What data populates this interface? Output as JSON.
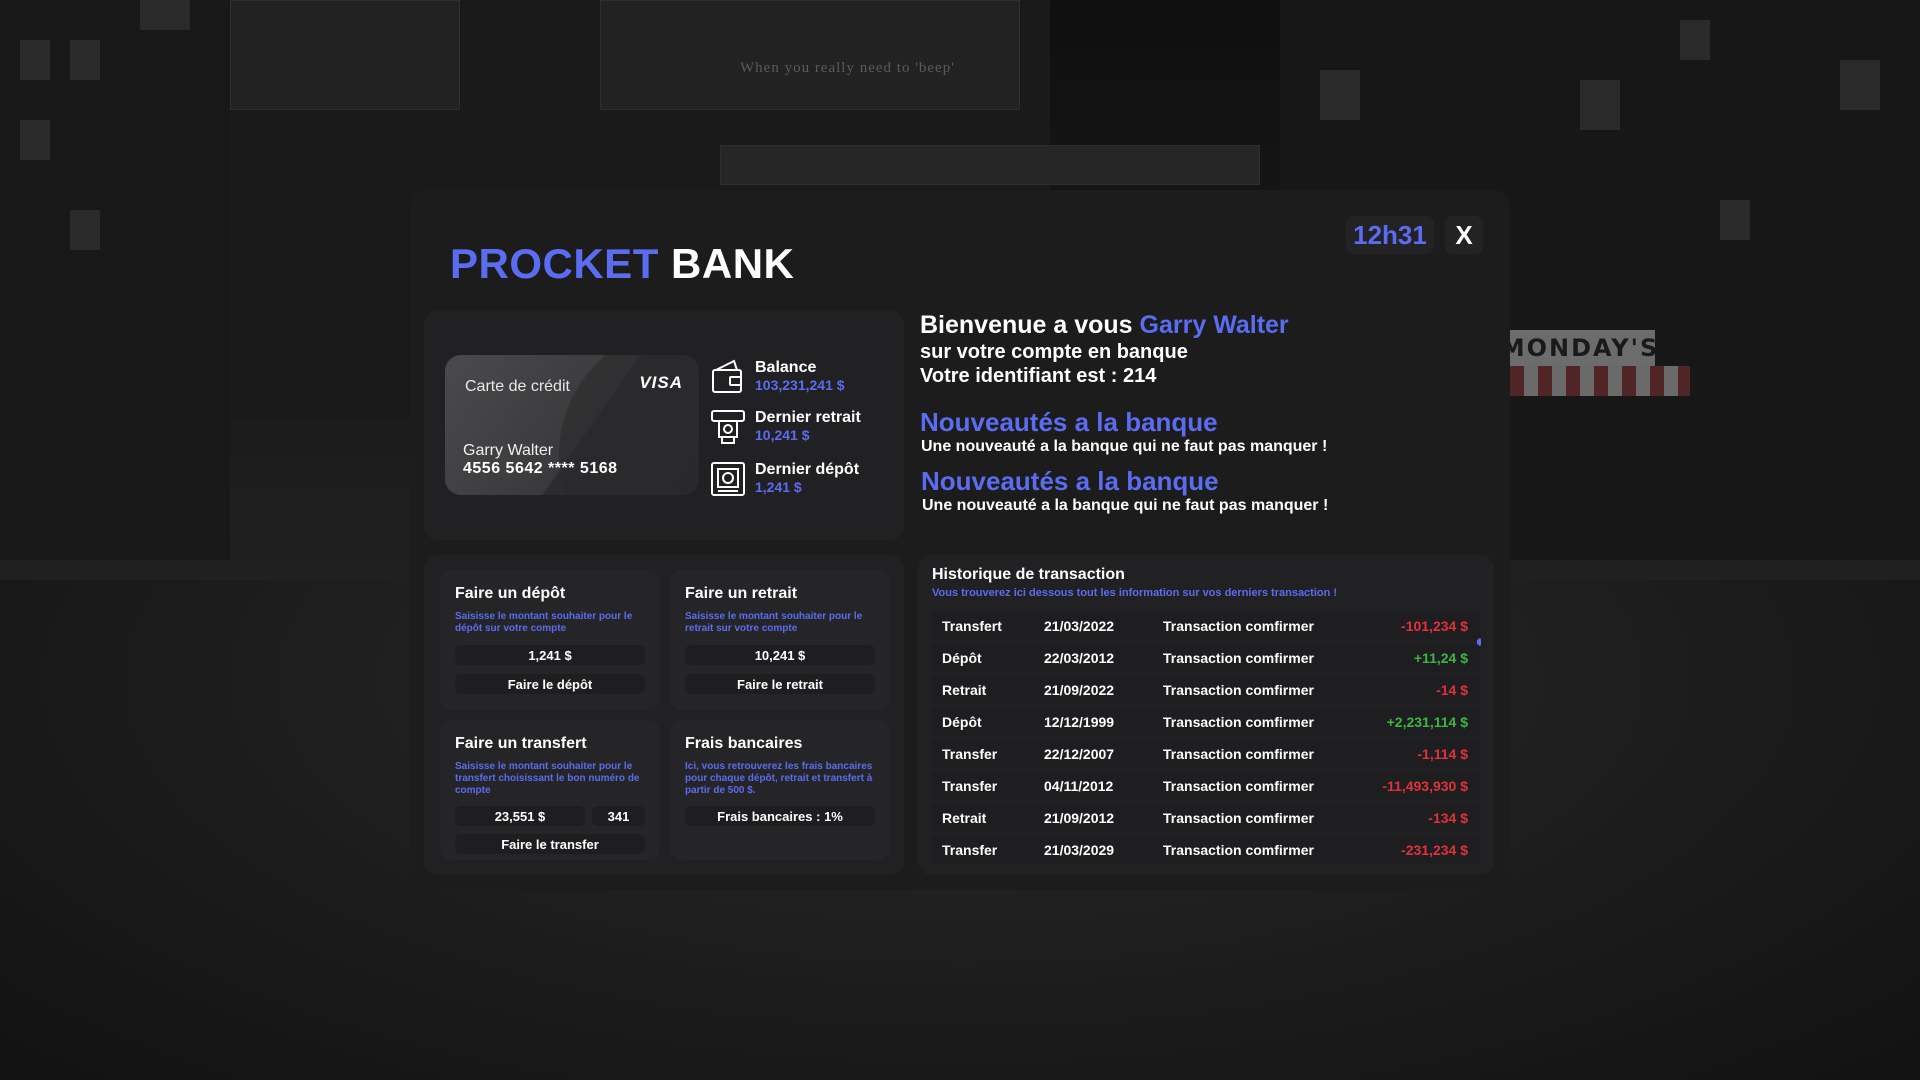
{
  "background": {
    "billboard_text": "When you really need to 'beep'",
    "shop_sign": "MONDAY'S"
  },
  "header": {
    "brand_accent": "PROCKET",
    "brand_rest": "BANK",
    "clock": "12h31",
    "close_label": "X"
  },
  "card": {
    "title": "Carte de crédit",
    "network": "VISA",
    "holder": "Garry Walter",
    "number": "4556 5642 **** 5168"
  },
  "stats": [
    {
      "label": "Balance",
      "value": "103,231,241 $",
      "icon": "wallet-icon"
    },
    {
      "label": "Dernier retrait",
      "value": "10,241 $",
      "icon": "atm-withdraw-icon"
    },
    {
      "label": "Dernier dépôt",
      "value": "1,241 $",
      "icon": "atm-deposit-icon"
    }
  ],
  "welcome": {
    "line1_prefix": "Bienvenue a vous",
    "user_name": "Garry Walter",
    "line2": "sur votre compte en banque",
    "line3": "Votre identifiant est : 214"
  },
  "news": [
    {
      "title": "Nouveautés a la banque",
      "text": "Une nouveauté a la banque qui ne faut pas manquer !"
    },
    {
      "title": "Nouveautés a la banque",
      "text": "Une nouveauté a la banque qui ne faut pas manquer !"
    }
  ],
  "deposit": {
    "title": "Faire un dépôt",
    "desc": "Saisisse le montant souhaiter pour le dépôt sur votre compte",
    "amount": "1,241 $",
    "button": "Faire le dépôt"
  },
  "withdraw": {
    "title": "Faire un retrait",
    "desc": "Saisisse le montant souhaiter pour le retrait sur votre compte",
    "amount": "10,241 $",
    "button": "Faire le retrait"
  },
  "transfer": {
    "title": "Faire un transfert",
    "desc": "Saisisse le montant souhaiter pour le transfert choisissant le bon numéro de compte",
    "amount": "23,551 $",
    "account": "341",
    "button": "Faire le transfer"
  },
  "fees": {
    "title": "Frais bancaires",
    "desc": "Ici, vous retrouverez les frais bancaires pour chaque dépôt, retrait et transfert à partir de 500 $.",
    "value": "Frais bancaires : 1%"
  },
  "transactions": {
    "title": "Historique de transaction",
    "subtitle": "Vous trouverez ici dessous tout les information sur vos derniers transaction !",
    "rows": [
      {
        "type": "Transfert",
        "date": "21/03/2022",
        "status": "Transaction comfirmer",
        "amount": "-101,234 $",
        "sign": "neg"
      },
      {
        "type": "Dépôt",
        "date": "22/03/2012",
        "status": "Transaction comfirmer",
        "amount": "+11,24 $",
        "sign": "pos"
      },
      {
        "type": "Retrait",
        "date": "21/09/2022",
        "status": "Transaction comfirmer",
        "amount": "-14 $",
        "sign": "neg"
      },
      {
        "type": "Dépôt",
        "date": "12/12/1999",
        "status": "Transaction comfirmer",
        "amount": "+2,231,114 $",
        "sign": "pos"
      },
      {
        "type": "Transfer",
        "date": "22/12/2007",
        "status": "Transaction comfirmer",
        "amount": "-1,114 $",
        "sign": "neg"
      },
      {
        "type": "Transfer",
        "date": "04/11/2012",
        "status": "Transaction comfirmer",
        "amount": "-11,493,930 $",
        "sign": "neg"
      },
      {
        "type": "Retrait",
        "date": "21/09/2012",
        "status": "Transaction comfirmer",
        "amount": "-134 $",
        "sign": "neg"
      },
      {
        "type": "Transfer",
        "date": "21/03/2029",
        "status": "Transaction comfirmer",
        "amount": "-231,234 $",
        "sign": "neg"
      }
    ]
  },
  "colors": {
    "accent": "#5a6cf0",
    "negative": "#e0323a",
    "positive": "#3db545",
    "panel": "#1c1c1d"
  }
}
